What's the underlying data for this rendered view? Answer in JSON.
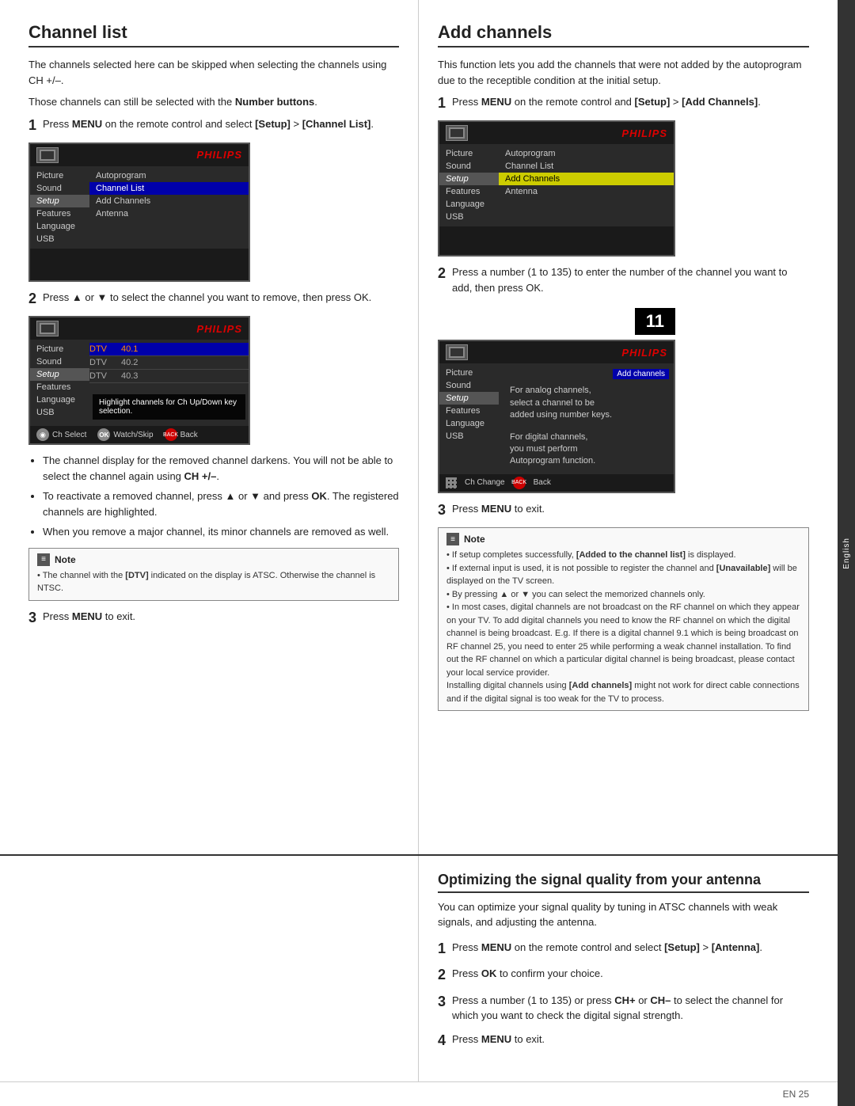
{
  "page": {
    "side_tab": "English",
    "page_number": "EN  25"
  },
  "channel_list": {
    "title": "Channel list",
    "intro1": "The channels selected here can be skipped when selecting the channels using CH +/–.",
    "intro2": "Those channels can still be selected with the Number buttons.",
    "step1": {
      "num": "1",
      "text_prefix": "Press ",
      "menu_bold": "MENU",
      "text_mid": " on the remote control and select ",
      "setup_bold": "[Setup]",
      "text_gt": " > ",
      "channel_bold": "[Channel List]",
      "text_end": "."
    },
    "screen1": {
      "philips": "PHILIPS",
      "menu_items_left": [
        "Picture",
        "Sound",
        "Setup",
        "Features",
        "Language",
        "USB"
      ],
      "menu_items_right": [
        "Autoprogram",
        "Channel List",
        "Add Channels",
        "Antenna"
      ],
      "selected_left": "Setup",
      "selected_right": "Channel List"
    },
    "step2": {
      "num": "2",
      "text": "Press ▲ or ▼ to select the channel you want to remove, then press OK."
    },
    "screen2": {
      "philips": "PHILIPS",
      "menu_items_left": [
        "Picture",
        "Sound",
        "Setup",
        "Features",
        "Language",
        "USB"
      ],
      "dtv_rows": [
        {
          "label": "DTV",
          "num": "40.1",
          "active": true
        },
        {
          "label": "DTV",
          "num": "40.2",
          "active": false
        },
        {
          "label": "DTV",
          "num": "40.3",
          "active": false
        }
      ],
      "tooltip": "Highlight channels for Ch Up/Down key selection.",
      "selected_left": "Setup",
      "bottom_buttons": [
        {
          "icon": "circle",
          "label": "Ch Select"
        },
        {
          "icon": "ok",
          "label": "Watch/Skip"
        },
        {
          "icon": "back",
          "label": "Back"
        }
      ]
    },
    "bullets": [
      "The channel display for the removed channel darkens. You will not be able to select the channel again using CH +/–.",
      "To reactivate a removed channel, press ▲ or ▼ and press OK. The registered channels are highlighted.",
      "When you remove a major channel, its minor channels are removed as well."
    ],
    "note": {
      "label": "Note",
      "text": "• The channel with the [DTV] indicated on the display is ATSC. Otherwise the channel is NTSC."
    },
    "step3": {
      "num": "3",
      "text_prefix": "Press ",
      "menu_bold": "MENU",
      "text_end": " to exit."
    }
  },
  "add_channels": {
    "title": "Add channels",
    "intro": "This function lets you add the channels that were not added by the autoprogram due to the receptible condition at the initial setup.",
    "step1": {
      "num": "1",
      "text_prefix": "Press ",
      "menu_bold": "MENU",
      "text_mid": " on the remote control and ",
      "setup_bold": "[Setup]",
      "text_gt": " > ",
      "add_bold": "[Add Channels]",
      "text_end": "."
    },
    "screen1": {
      "philips": "PHILIPS",
      "menu_items_left": [
        "Picture",
        "Sound",
        "Setup",
        "Features",
        "Language",
        "USB"
      ],
      "menu_items_right": [
        "Autoprogram",
        "Channel List",
        "Add Channels",
        "Antenna"
      ],
      "selected_left": "Setup",
      "selected_right": "Add Channels"
    },
    "step2": {
      "num": "2",
      "text": "Press a number (1 to 135) to enter the number of the channel you want to add, then press OK."
    },
    "number_display": "11",
    "screen2": {
      "philips": "PHILIPS",
      "badge": "Add channels",
      "menu_items_left": [
        "Picture",
        "Sound",
        "Setup",
        "Features",
        "Language",
        "USB"
      ],
      "analog_text": "For analog channels, select a channel to be added using number keys.",
      "digital_text": "For digital channels, you must perform Autoprogram function.",
      "selected_left": "Setup",
      "bottom_buttons": [
        {
          "icon": "grid",
          "label": "Ch Change"
        },
        {
          "icon": "back",
          "label": "Back"
        }
      ]
    },
    "step3": {
      "num": "3",
      "text_prefix": "Press ",
      "menu_bold": "MENU",
      "text_end": " to exit."
    },
    "note": {
      "label": "Note",
      "bullets": [
        "If setup completes successfully, [Added to the channel list] is displayed.",
        "If external input is used, it is not possible to register the channel and [Unavailable] will be displayed on the TV screen.",
        "By pressing ▲ or ▼ you can select the memorized channels only.",
        "In most cases, digital channels are not broadcast on the RF channel on which they appear on your TV. To add digital channels you need to know the RF channel on which the digital channel is being broadcast. E.g. If there is a digital channel 9.1 which is being broadcast on RF channel 25, you need to enter 25 while performing a weak channel installation. To find out the RF channel on which a particular digital channel is being broadcast, please contact your local service provider.",
        "Installing digital channels using [Add channels] might not work for direct cable connections and if the digital signal is too weak for the TV to process."
      ]
    }
  },
  "optimize_signal": {
    "title": "Optimizing the signal quality from your antenna",
    "intro": "You can optimize your signal quality by tuning in ATSC channels with weak signals, and adjusting the antenna.",
    "steps": [
      {
        "num": "1",
        "text_prefix": "Press ",
        "menu_bold": "MENU",
        "text_mid": " on the remote control and select ",
        "setup_bold": "[Setup]",
        "text_gt": " > ",
        "antenna_bold": "[Antenna]",
        "text_end": "."
      },
      {
        "num": "2",
        "text_prefix": "Press ",
        "ok_bold": "OK",
        "text_end": " to confirm your choice."
      },
      {
        "num": "3",
        "text_prefix": "Press a number (1 to 135) or press ",
        "chplus_bold": "CH+",
        "text_or": " or ",
        "chminus_bold": "CH–",
        "text_end": " to select the channel for which you want to check the digital signal strength."
      },
      {
        "num": "4",
        "text_prefix": "Press ",
        "menu_bold": "MENU",
        "text_end": " to exit."
      }
    ]
  }
}
